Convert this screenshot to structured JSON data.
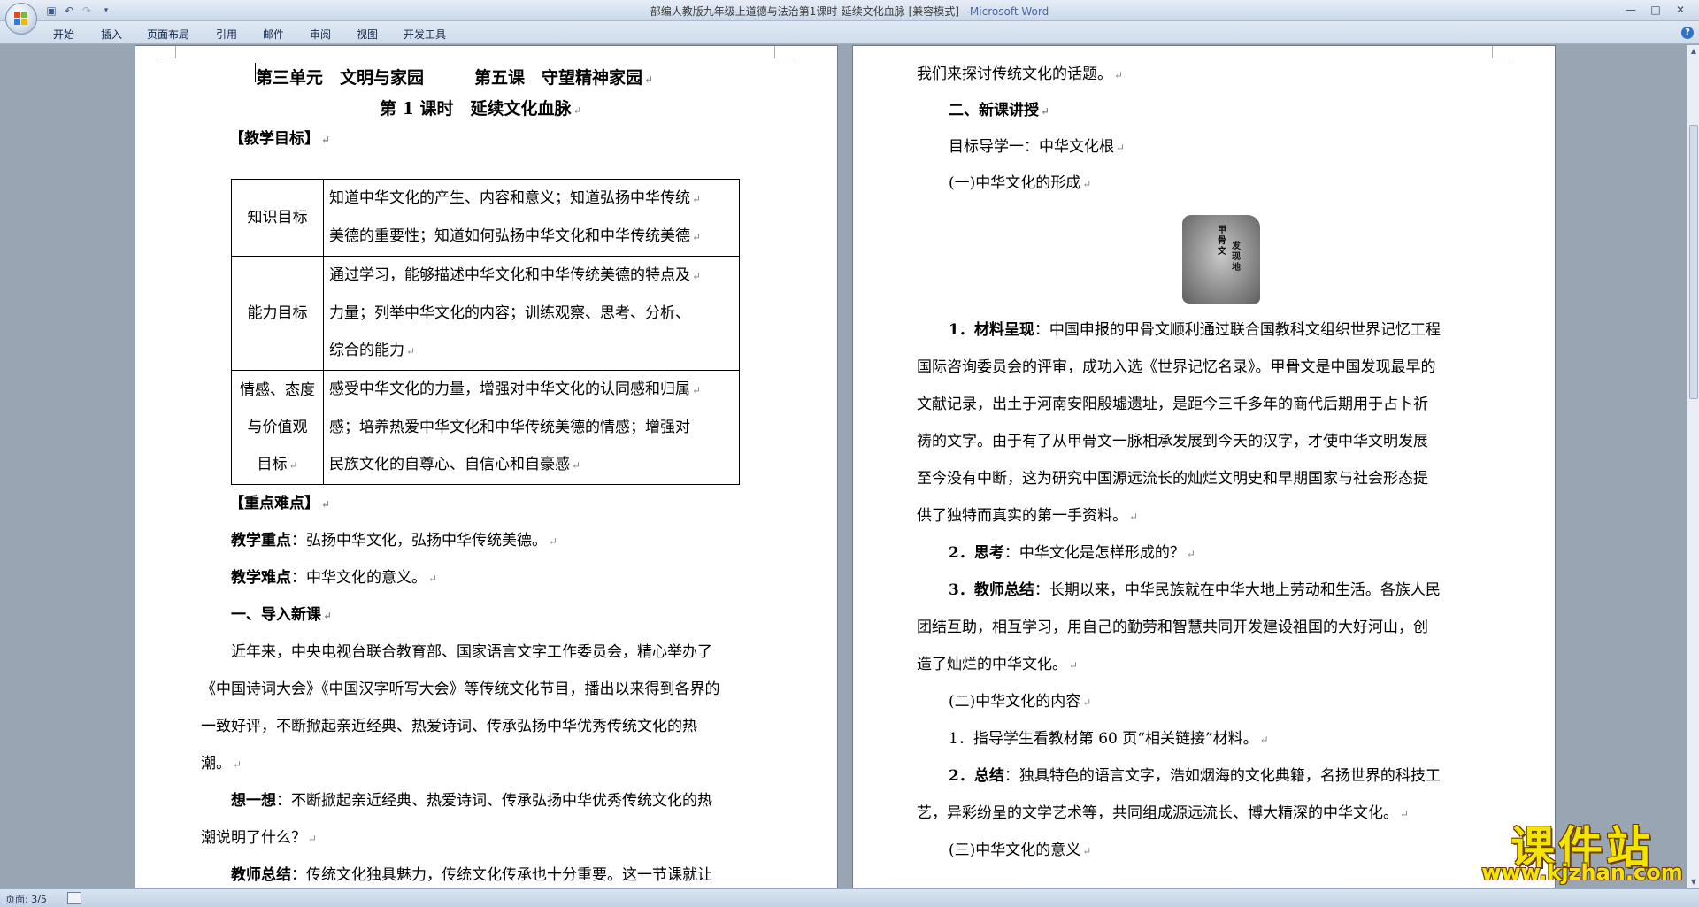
{
  "window": {
    "title": "部编人教版九年级上道德与法治第1课时-延续文化血脉 [兼容模式]",
    "title_sep": " - ",
    "app_name": "Microsoft Word",
    "controls": {
      "minimize": "—",
      "maximize": "□",
      "close": "✕"
    }
  },
  "quick_access": {
    "save_icon": "save-icon",
    "undo_icon": "undo-icon",
    "redo_icon": "redo-icon",
    "customize_icon": "customize-icon"
  },
  "ribbon": {
    "tabs": [
      {
        "label": "开始"
      },
      {
        "label": "插入"
      },
      {
        "label": "页面布局"
      },
      {
        "label": "引用"
      },
      {
        "label": "邮件"
      },
      {
        "label": "审阅"
      },
      {
        "label": "视图"
      },
      {
        "label": "开发工具"
      }
    ],
    "help": "?"
  },
  "left_page": {
    "title_line": "第三单元　文明与家园　　　第五课　守望精神家园",
    "subtitle": "第 1 课时　延续文化血脉",
    "objectives_heading": "【教学目标】",
    "objectives": [
      {
        "label": "知识目标",
        "lines": [
          "知道中华文化的产生、内容和意义；知道弘扬中华传统",
          "美德的重要性；知道如何弘扬中华文化和中华传统美德"
        ]
      },
      {
        "label": "能力目标",
        "lines": [
          "通过学习，能够描述中华文化和中华传统美德的特点及",
          "力量；列举中华文化的内容；训练观察、思考、分析、",
          "综合的能力"
        ]
      },
      {
        "label_lines": [
          "情感、态度",
          "与价值观",
          "目标"
        ],
        "lines": [
          "感受中华文化的力量，增强对中华文化的认同感和归属",
          "感；培养热爱中华文化和中华传统美德的情感；增强对",
          "民族文化的自尊心、自信心和自豪感"
        ]
      }
    ],
    "keypoints_heading": "【重点难点】",
    "focus_label": "教学重点",
    "focus_text": "：弘扬中华文化，弘扬中华传统美德。",
    "difficulty_label": "教学难点",
    "difficulty_text": "：中华文化的意义。",
    "section1_heading": "一、导入新课",
    "intro_lines": [
      "近年来，中央电视台联合教育部、国家语言文字工作委员会，精心举办了",
      "《中国诗词大会》《中国汉字听写大会》等传统文化节目，播出以来得到各界的",
      "一致好评，不断掀起亲近经典、热爱诗词、传承弘扬中华优秀传统文化的热",
      "潮。"
    ],
    "think_label": "想一想",
    "think_lines": [
      "：不断掀起亲近经典、热爱诗词、传承弘扬中华优秀传统文化的热",
      "潮说明了什么？"
    ],
    "teacher_label": "教师总结",
    "teacher_text": "：传统文化独具魅力，传统文化传承也十分重要。这一节课就让"
  },
  "right_page": {
    "line1": "我们来探讨传统文化的话题。",
    "section2_heading": "二、新课讲授",
    "goal1": "目标导学一：中华文化根",
    "sub1": "(一)中华文化的形成",
    "image_caption_chars": [
      "甲",
      "骨",
      "文",
      "发",
      "现",
      "地"
    ],
    "material_label": "1．材料呈现",
    "material_lines": [
      "：中国申报的甲骨文顺利通过联合国教科文组织世界记忆工程",
      "国际咨询委员会的评审，成功入选《世界记忆名录》。甲骨文是中国发现最早的",
      "文献记录，出土于河南安阳殷墟遗址，是距今三千多年的商代后期用于占卜祈",
      "祷的文字。由于有了从甲骨文一脉相承发展到今天的汉字，才使中华文明发展",
      "至今没有中断，这为研究中国源远流长的灿烂文明史和早期国家与社会形态提",
      "供了独特而真实的第一手资料。"
    ],
    "q2_label": "2．思考",
    "q2_text": "：中华文化是怎样形成的？",
    "q3_label": "3．教师总结",
    "q3_lines": [
      "：长期以来，中华民族就在中华大地上劳动和生活。各族人民",
      "团结互助，相互学习，用自己的勤劳和智慧共同开发建设祖国的大好河山，创",
      "造了灿烂的中华文化。"
    ],
    "sub2": "(二)中华文化的内容",
    "p1": "1．指导学生看教材第 60 页“相关链接”材料。",
    "p2_label": "2．总结",
    "p2_lines": [
      "：独具特色的语言文字，浩如烟海的文化典籍，名扬世界的科技工",
      "艺，异彩纷呈的文学艺术等，共同组成源远流长、博大精深的中华文化。"
    ],
    "sub3": "(三)中华文化的意义"
  },
  "para_mark": "↵",
  "status_bar": {
    "page": "页面: 3/5"
  },
  "watermark": {
    "text": "课件站",
    "url": "www.kjzhan.com"
  }
}
